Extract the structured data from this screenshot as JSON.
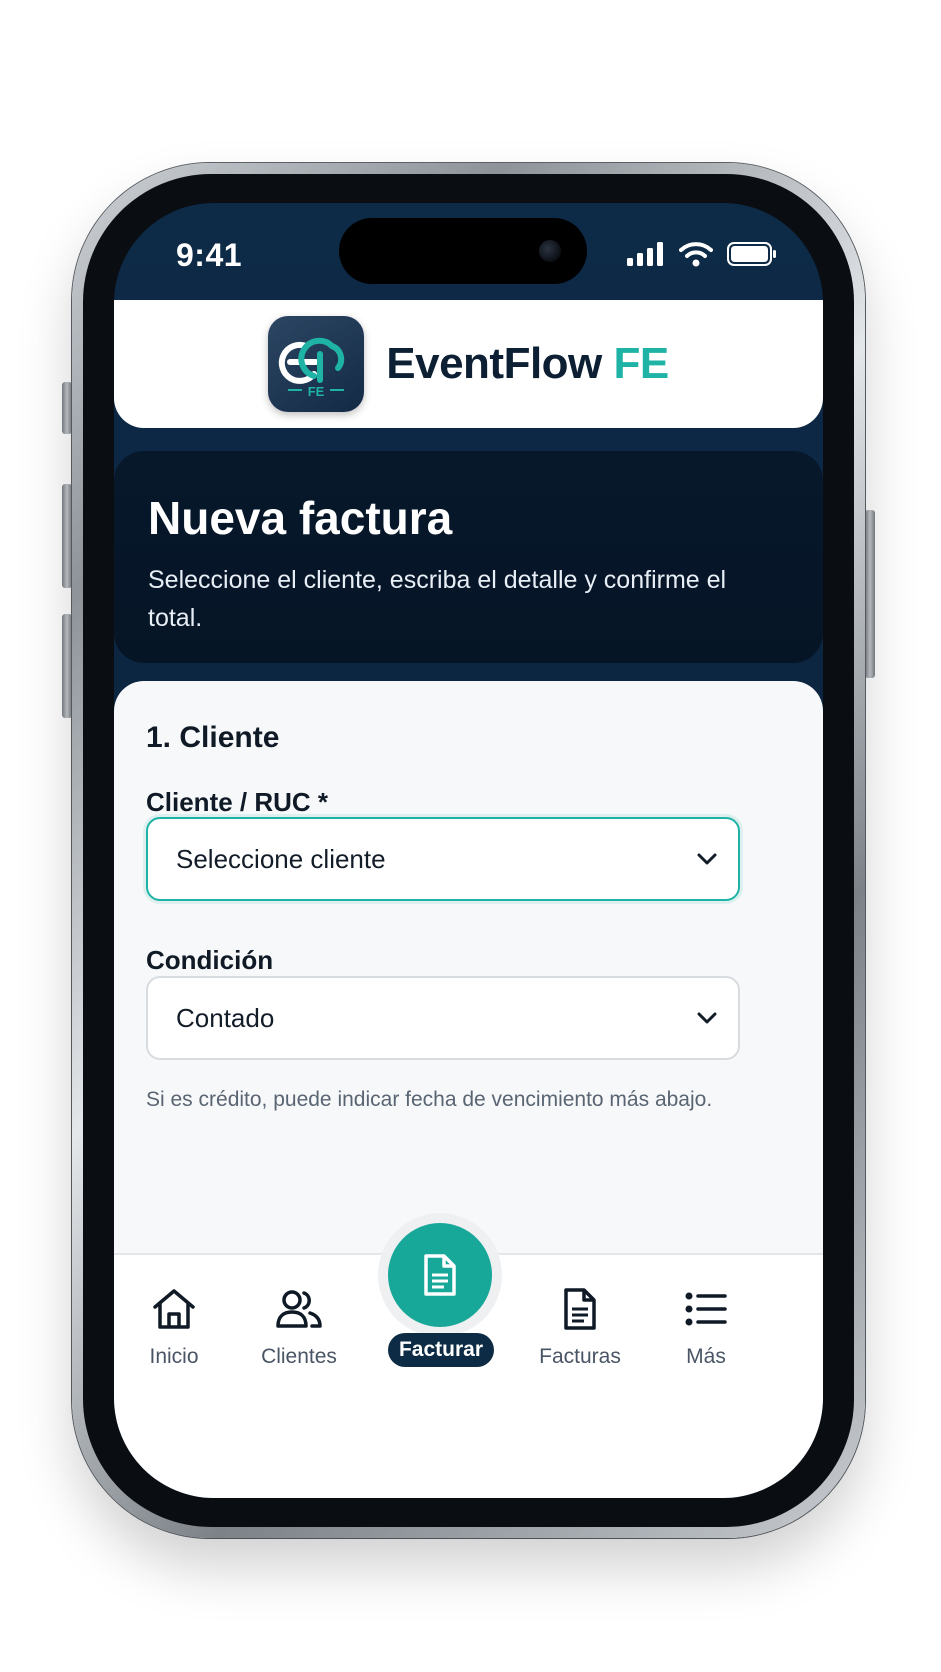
{
  "status_bar": {
    "time": "9:41"
  },
  "brand": {
    "logo_letters": "ep",
    "logo_sub": "FE",
    "name": "EventFlow",
    "name_accent": "FE",
    "accent_color": "#1fb3a6"
  },
  "hero": {
    "title": "Nueva factura",
    "subtitle": "Seleccione el cliente, escriba el detalle y confirme el total."
  },
  "form": {
    "section_title": "1. Cliente",
    "client_label": "Cliente / RUC *",
    "client_value": "Seleccione cliente",
    "condition_label": "Condición",
    "condition_value": "Contado",
    "helper": "Si es crédito, puede indicar fecha de vencimiento más abajo."
  },
  "nav": {
    "items": [
      {
        "label": "Inicio",
        "icon": "home-icon"
      },
      {
        "label": "Clientes",
        "icon": "users-icon"
      },
      {
        "label": "Facturar",
        "icon": "document-icon",
        "active": true
      },
      {
        "label": "Facturas",
        "icon": "invoice-icon"
      },
      {
        "label": "Más",
        "icon": "list-icon"
      }
    ]
  }
}
